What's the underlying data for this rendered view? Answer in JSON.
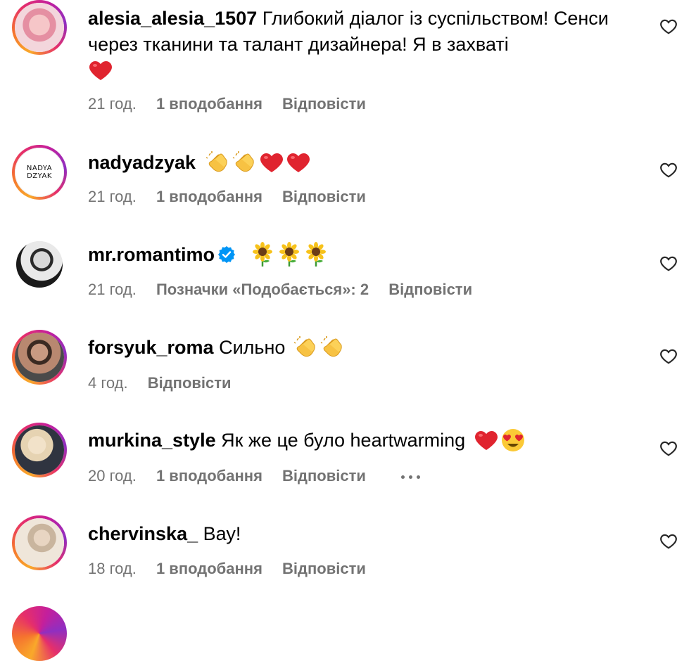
{
  "comments": [
    {
      "username": "alesia_alesia_1507",
      "text": "Глибокий діалог із суспільством! Сенси через тканини та талант дизайнера! Я в захваті",
      "emoji": [
        "red-heart"
      ],
      "time": "21 год.",
      "likes": "1 вподобання",
      "reply": "Відповісти"
    },
    {
      "username": "nadyadzyak",
      "avatar_text": "NADYA DZYAK",
      "text": "",
      "emoji": [
        "clapping-hands",
        "clapping-hands",
        "red-heart",
        "red-heart"
      ],
      "time": "21 год.",
      "likes": "1 вподобання",
      "reply": "Відповісти"
    },
    {
      "username": "mr.romantimo",
      "verified": true,
      "text": "",
      "emoji": [
        "sunflower",
        "sunflower",
        "sunflower"
      ],
      "time": "21 год.",
      "likes": "Позначки «Подобається»: 2",
      "reply": "Відповісти"
    },
    {
      "username": "forsyuk_roma",
      "text": "Сильно",
      "emoji": [
        "clapping-hands",
        "clapping-hands"
      ],
      "time": "4 год.",
      "likes": "",
      "reply": "Відповісти"
    },
    {
      "username": "murkina_style",
      "text": "Як же це було heartwarming",
      "emoji": [
        "red-heart",
        "heart-eyes-face"
      ],
      "time": "20 год.",
      "likes": "1 вподобання",
      "reply": "Відповісти",
      "more_options": true
    },
    {
      "username": "chervinska_",
      "text": "Вау!",
      "emoji": [],
      "time": "18 год.",
      "likes": "1 вподобання",
      "reply": "Відповісти"
    }
  ],
  "icons": {
    "like": "heart-outline-icon",
    "verified": "verified-badge-icon",
    "more": "more-options-icon"
  },
  "colors": {
    "meta_text": "#737373",
    "verified_blue": "#0095f6",
    "heart_red": "#e0242f",
    "story_ring_start": "#f9a92a",
    "story_ring_end": "#c41f9c"
  }
}
